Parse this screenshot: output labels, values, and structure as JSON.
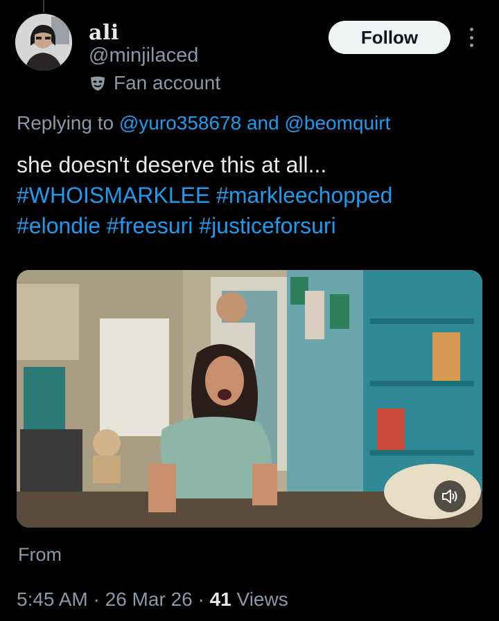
{
  "author": {
    "display_name": "ali",
    "handle": "@minjilaced",
    "label": "Fan account"
  },
  "actions": {
    "follow_label": "Follow"
  },
  "reply": {
    "prefix": "Replying to",
    "mention_1": "@yuro358678",
    "connector": "and",
    "mention_2": "@beomquirt"
  },
  "tweet": {
    "text": "she doesn't deserve this at all...",
    "hashtags": [
      "#WHOISMARKLEE",
      "#markleechopped",
      "#elondie",
      "#freesuri",
      "#justiceforsuri"
    ]
  },
  "media": {
    "type": "video",
    "muted": true
  },
  "from_label": "From",
  "meta": {
    "time": "5:45 AM",
    "separator": "·",
    "date": "26 Mar 26",
    "views_count": "41",
    "views_label": "Views"
  },
  "colors": {
    "background": "#000000",
    "link": "#1d9bf0",
    "secondary_text": "#8b98a5",
    "primary_text": "#e7e9ea"
  }
}
